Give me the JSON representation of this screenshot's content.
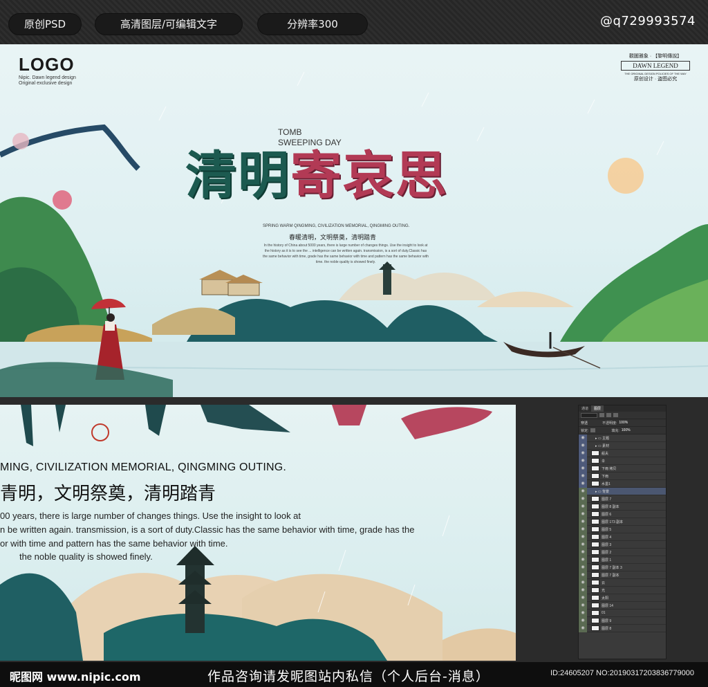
{
  "topbar": {
    "tag1": "原创PSD",
    "tag2": "高清图层/可编辑文字",
    "tag3": "分辨率300",
    "qq": "@q729993574"
  },
  "banner": {
    "logo": "LOGO",
    "logo_sub1": "Nipic. Dawn legend design",
    "logo_sub2": "Original exclusive design",
    "stamp_top": "觀圖雅象 · 【黎明傳說】",
    "stamp_box": "DAWN LEGEND",
    "stamp_small": "THE ORIGINAL DESIGN POLICIES OF THE WAY",
    "stamp_bottom": "原创设计 · 盗图必究",
    "tomb1": "TOMB",
    "tomb2": "SWEEPING DAY",
    "headline_a": "清明",
    "headline_b": "寄哀思",
    "sub_en": "SPRING WARM QINGMING, CIVILIZATION MEMORIAL, QINGMING OUTING.",
    "sub_cn": "春暖清明，文明祭奠，清明踏青",
    "para": "In the history of China about 5000 years, there is large number of changes things. Use the insight to look at the history as it is to see the ... intelligence can be written again. transmission, is a sort of duty.Classic has the same behavior with time, grade has the same behavior with time and pattern has the same behavior with time. the noble quality is showed finely."
  },
  "detail": {
    "en": "MING, CIVILIZATION MEMORIAL, QINGMING OUTING.",
    "cn": "青明，文明祭奠，清明踏青",
    "p1": "00 years, there is large number of changes things. Use the insight to look at",
    "p2": "n be written again. transmission, is a sort of duty.Classic has the same behavior with time, grade has the",
    "p3": "or with time and pattern has the same behavior with time.",
    "p4": "the noble quality is showed finely."
  },
  "layers_panel": {
    "tabs": [
      "通道",
      "图层"
    ],
    "mode": "穿透",
    "opacity_label": "不透明度:",
    "opacity": "100%",
    "lock_label": "锁定:",
    "fill_label": "填充:",
    "fill": "100%",
    "rows": [
      {
        "name": "主题",
        "type": "folder",
        "eye": "b"
      },
      {
        "name": "素材",
        "type": "folder",
        "eye": "b"
      },
      {
        "name": "船夫",
        "type": "layer",
        "eye": "b"
      },
      {
        "name": "伞",
        "type": "layer",
        "eye": "b"
      },
      {
        "name": "下雨 拷贝",
        "type": "layer",
        "eye": "b"
      },
      {
        "name": "下雨",
        "type": "layer",
        "eye": "b"
      },
      {
        "name": "水墨1",
        "type": "layer",
        "eye": "b"
      },
      {
        "name": "背景",
        "type": "folder",
        "eye": "g",
        "selected": true
      },
      {
        "name": "图层 7",
        "type": "layer",
        "eye": "g"
      },
      {
        "name": "图层 8 副本",
        "type": "layer",
        "eye": "g"
      },
      {
        "name": "图层 6",
        "type": "layer",
        "eye": "g"
      },
      {
        "name": "图层 173 副本",
        "type": "layer",
        "eye": "g"
      },
      {
        "name": "图层 5",
        "type": "layer",
        "eye": "g"
      },
      {
        "name": "图层 4",
        "type": "layer",
        "eye": "g"
      },
      {
        "name": "图层 3",
        "type": "layer",
        "eye": "g"
      },
      {
        "name": "图层 2",
        "type": "layer",
        "eye": "g"
      },
      {
        "name": "图层 1",
        "type": "layer",
        "eye": "g"
      },
      {
        "name": "图层 7 副本 3",
        "type": "layer",
        "eye": "g"
      },
      {
        "name": "图层 7 副本",
        "type": "layer",
        "eye": "g"
      },
      {
        "name": "云",
        "type": "layer",
        "eye": "g"
      },
      {
        "name": "光",
        "type": "layer",
        "eye": "g"
      },
      {
        "name": "太阳",
        "type": "layer",
        "eye": "g"
      },
      {
        "name": "图层 14",
        "type": "layer",
        "eye": "g"
      },
      {
        "name": "01",
        "type": "layer",
        "eye": "g"
      },
      {
        "name": "图层 9",
        "type": "layer",
        "eye": "g"
      },
      {
        "name": "图层 8",
        "type": "layer",
        "eye": "g"
      }
    ]
  },
  "footer": {
    "site": "昵图网 www.nipic.com",
    "message": "作品咨询请发昵图站内私信（个人后台-消息）",
    "id": "ID:24605207 NO:20190317203836779000"
  },
  "colors": {
    "ink_green": "#1c5a50",
    "plum": "#b23a55",
    "sky": "#e9f4f5",
    "dark_bar": "#2b2b2b"
  }
}
